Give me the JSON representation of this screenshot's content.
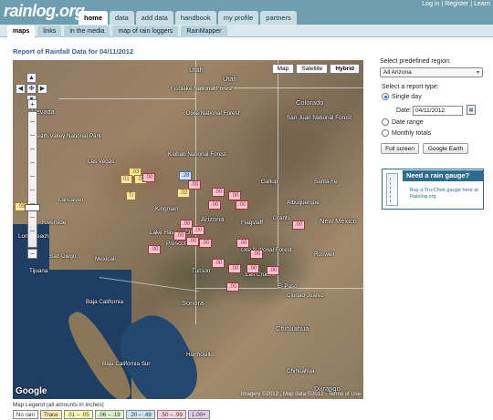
{
  "header": {
    "logo": "rainlog.org",
    "top_links": [
      "Log in",
      "Register",
      "Learn"
    ],
    "main_tabs": [
      "home",
      "data",
      "add data",
      "handbook",
      "my profile",
      "partners"
    ]
  },
  "subnav": {
    "tabs": [
      "maps",
      "links",
      "in the media",
      "map of rain loggers",
      "RainMapper"
    ]
  },
  "report_title": "Report of Rainfall Data for 04/11/2012",
  "map": {
    "type_buttons": [
      "Map",
      "Satellite",
      "Hybrid"
    ],
    "places": {
      "nevada": "Nevada",
      "utah": "Utah",
      "utah2": "Utah",
      "colorado": "Colorado",
      "arizona": "Arizona",
      "new_mexico": "New Mexico",
      "death_valley": "Death Valley National Park",
      "las_vegas": "Las Vegas",
      "fishlake": "Fishlake National Forest",
      "dixie": "Dixie National Forest",
      "kaibab": "Kaibab National Forest",
      "san_juan": "San Juan National Forest",
      "santa_fe": "Santa Fe",
      "albuquerque": "Albuquerque",
      "gila": "Gila National Forest",
      "riverside": "Riverside",
      "long_beach": "Long Beach",
      "san_diego": "San Diego",
      "tijuana": "Tijuana",
      "mexicali": "Mexicali",
      "tucson": "Tucson",
      "el_paso": "El Paso",
      "ciudad_juarez": "Ciudad Juárez",
      "chihuahua_city": "Chihuahua",
      "hermosillo": "Hermosillo",
      "sonora": "Sonora",
      "chihuahua_state": "Chihuahua",
      "baja": "Baja California",
      "bcs": "Baja California Sur",
      "durango": "Durango",
      "lake_havasu": "Lake Havasu City",
      "kingman": "Kingman",
      "flagstaff": "Flagstaff",
      "prescott": "Prescott",
      "lancaster": "Lancaster",
      "gallup": "Gallup",
      "roswell": "Roswell",
      "las_cruces": "Las Cruces",
      "grants": "Grants"
    },
    "markers": [
      ".03",
      "01",
      ".05",
      ".00",
      "Tr",
      ".28",
      ".02",
      ".00",
      ".00",
      ".00",
      ".00",
      ".00",
      ".00",
      ".00",
      ".00",
      ".00",
      ".00",
      ".00",
      ".00",
      ".00",
      ".00",
      ".00",
      ".00",
      ".00",
      ".00",
      ".00",
      ".05"
    ],
    "google": "Google",
    "copyright": "Imagery ©2012 , Map data ©2012 - Terms of Use"
  },
  "legend": {
    "title": "Map Legend (all amounts in inches)",
    "items": [
      {
        "label": "No rain",
        "color": "#ffffff"
      },
      {
        "label": "Trace",
        "color": "#ffe9a8"
      },
      {
        "label": ".01 – .05",
        "color": "#ffffb0"
      },
      {
        "label": ".06 – .19",
        "color": "#d9f5c4"
      },
      {
        "label": ".20 – .49",
        "color": "#c7e6f2"
      },
      {
        "label": ".50 – .99",
        "color": "#ffd1dc"
      },
      {
        "label": "1.00+",
        "color": "#e6c9f2"
      }
    ]
  },
  "panel": {
    "region_label": "Select predefined region:",
    "region_value": "All Arizona",
    "report_type_label": "Select a report type:",
    "single_day": "Single day",
    "date_label": "Date:",
    "date_value": "04/11/2012",
    "date_range": "Date range",
    "monthly_totals": "Monthly totals",
    "full_screen": "Full screen",
    "google_earth": "Google Earth"
  },
  "ad": {
    "headline": "Need a rain gauge?",
    "text": "Buy a Tru-Chek gauge here at Rainlog.org"
  }
}
